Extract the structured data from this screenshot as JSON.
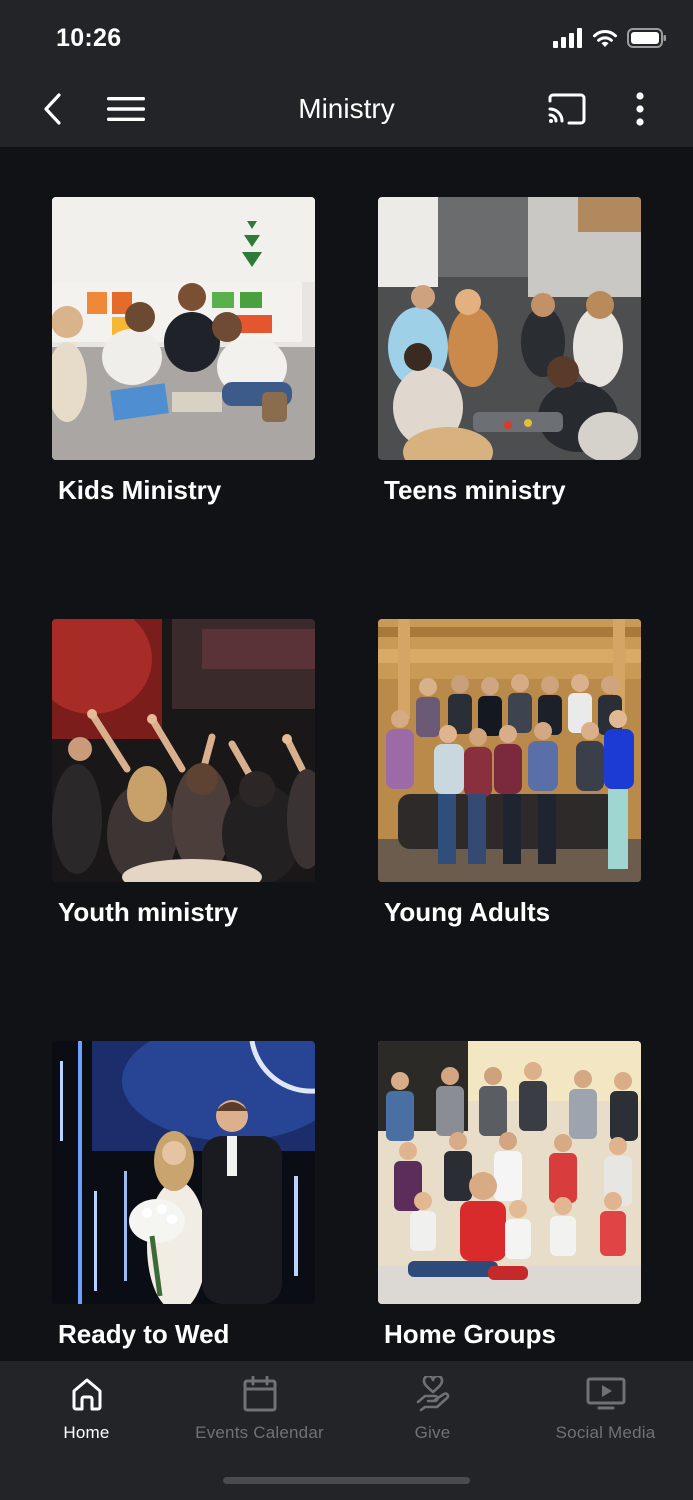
{
  "status_bar": {
    "time": "10:26"
  },
  "nav": {
    "title": "Ministry",
    "icons": [
      "back-icon",
      "menu-icon",
      "cast-icon",
      "more-vertical-icon"
    ]
  },
  "ministries": [
    {
      "label": "Kids Ministry"
    },
    {
      "label": "Teens ministry"
    },
    {
      "label": "Youth ministry"
    },
    {
      "label": "Young Adults"
    },
    {
      "label": "Ready to Wed"
    },
    {
      "label": "Home Groups"
    }
  ],
  "tabs": [
    {
      "label": "Home",
      "icon": "home-icon",
      "active": true
    },
    {
      "label": "Events Calendar",
      "icon": "calendar-icon",
      "active": false
    },
    {
      "label": "Give",
      "icon": "give-icon",
      "active": false
    },
    {
      "label": "Social Media",
      "icon": "social-media-icon",
      "active": false
    }
  ],
  "colors": {
    "background": "#111215",
    "bar": "#232427",
    "text": "#ffffff",
    "inactive_tab": "#6f7176"
  }
}
